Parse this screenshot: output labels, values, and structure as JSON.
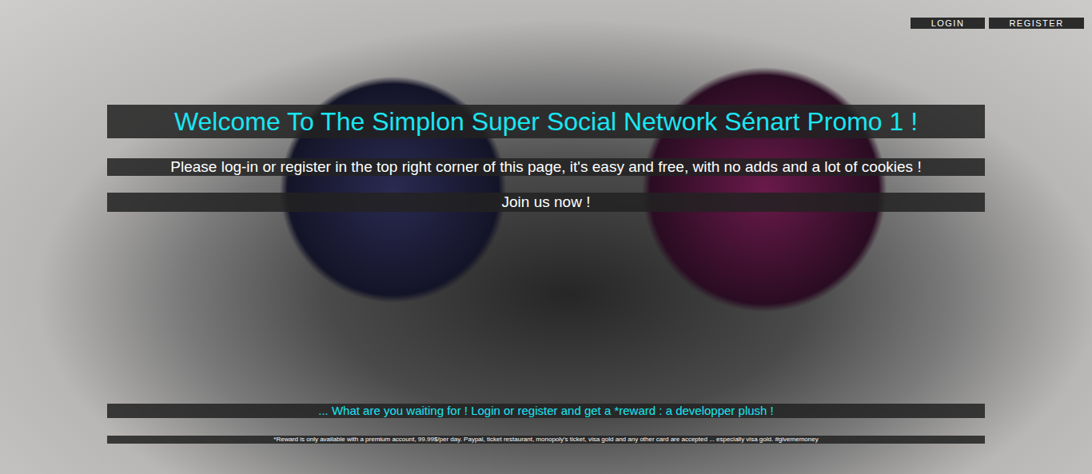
{
  "nav": [
    {
      "label": "LOGIN"
    },
    {
      "label": "REGISTER"
    }
  ],
  "hero": {
    "title": "Welcome To The Simplon Super Social Network Sénart Promo 1 !",
    "subtitle": "Please log-in or register in the top right corner of this page, it's easy and free, with no adds and a lot of cookies !",
    "cta": "Join us now !"
  },
  "promo": "... What are you waiting for ! Login or register and get a *reward : a developper plush !",
  "footnote": "*Reward is only available with a premium account, 99.99$/per day. Paypal, ticket restaurant, monopoly's ticket, visa gold and any other card are accepted ... especially visa gold. #givememoney"
}
